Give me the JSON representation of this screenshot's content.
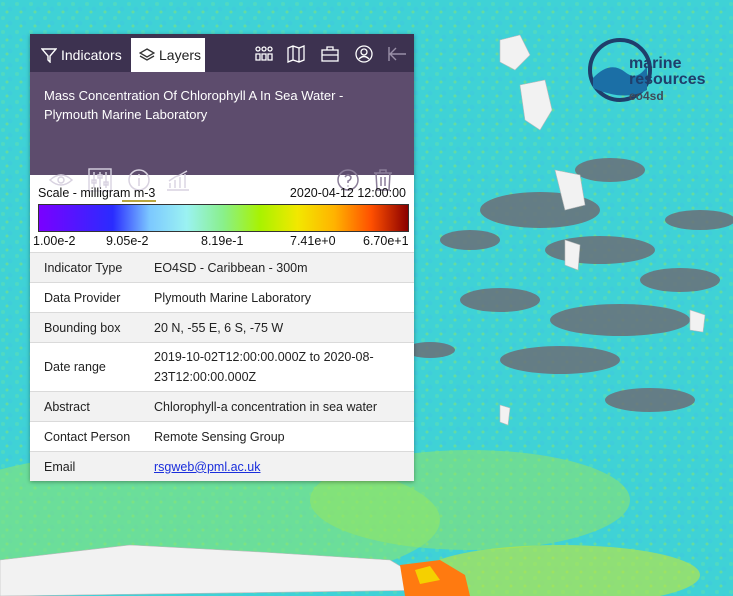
{
  "tabs": {
    "indicators": "Indicators",
    "layers": "Layers"
  },
  "layer": {
    "title": "Mass Concentration Of Chlorophyll A In Sea Water - Plymouth Marine Laboratory"
  },
  "scale": {
    "label": "Scale - milligram m-3",
    "date": "2020-04-12 12:00:00",
    "ticks": [
      "1.00e-2",
      "9.05e-2",
      "8.19e-1",
      "7.41e+0",
      "6.70e+1"
    ]
  },
  "info": {
    "indicator_type": {
      "key": "Indicator Type",
      "value": "EO4SD - Caribbean - 300m"
    },
    "data_provider": {
      "key": "Data Provider",
      "value": "Plymouth Marine Laboratory"
    },
    "bounding_box": {
      "key": "Bounding box",
      "value": "20 N, -55 E, 6 S, -75 W"
    },
    "date_range": {
      "key": "Date range",
      "value": "2019-10-02T12:00:00.000Z to 2020-08-23T12:00:00.000Z"
    },
    "abstract": {
      "key": "Abstract",
      "value": "Chlorophyll-a concentration in sea water"
    },
    "contact": {
      "key": "Contact Person",
      "value": "Remote Sensing Group"
    },
    "email": {
      "key": "Email",
      "value": "rsgweb@pml.ac.uk"
    }
  },
  "logo": {
    "line1": "marine",
    "line2": "resources",
    "line3": "eo4sd"
  },
  "colors": {
    "topbar": "#3d3250",
    "header": "#5d4c6d",
    "accent": "#b9a63f",
    "link": "#1a2edc"
  },
  "icons": [
    "funnel-icon",
    "layers-icon",
    "people-icon",
    "map-icon",
    "briefcase-icon",
    "user-icon",
    "collapse-arrow-icon",
    "eye-icon",
    "sliders-icon",
    "info-icon",
    "chart-icon",
    "help-icon",
    "trash-icon"
  ]
}
